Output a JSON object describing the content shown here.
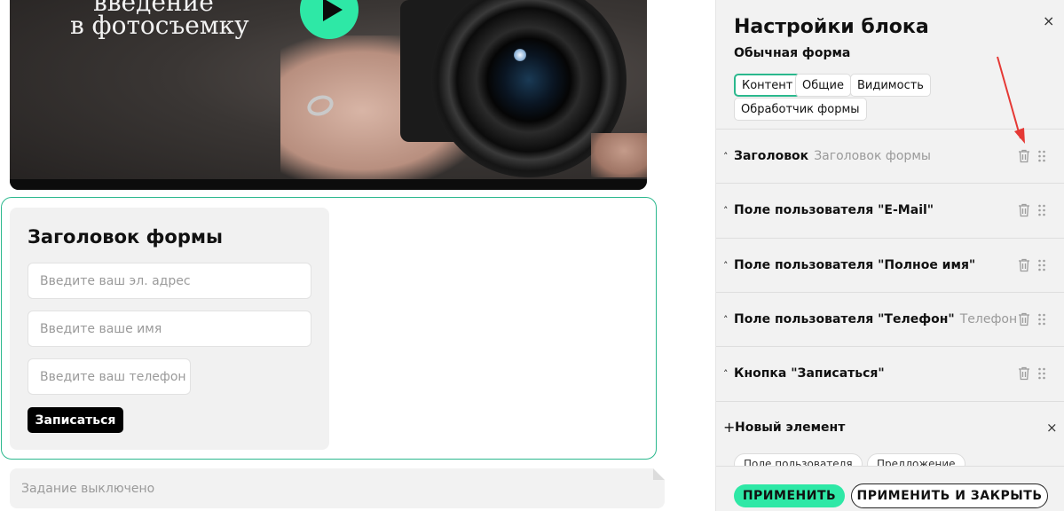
{
  "canvas": {
    "video": {
      "caption_line1": "введение",
      "caption_line2": "в фотосъемку"
    },
    "form": {
      "title": "Заголовок формы",
      "email_placeholder": "Введите ваш эл. адрес",
      "name_placeholder": "Введите ваше имя",
      "phone_placeholder": "Введите ваш телефон",
      "submit_label": "Записаться"
    },
    "task_status": "Задание выключено"
  },
  "panel": {
    "title": "Настройки блока",
    "subtitle": "Обычная форма",
    "close_icon": "×",
    "tabs": [
      {
        "label": "Контент",
        "active": true
      },
      {
        "label": "Общие",
        "active": false
      },
      {
        "label": "Видимость",
        "active": false
      },
      {
        "label": "Обработчик формы",
        "active": false
      }
    ],
    "items": [
      {
        "caret": "˄",
        "label": "Заголовок",
        "hint": "Заголовок формы"
      },
      {
        "caret": "˄",
        "label": "Поле пользователя \"E-Mail\"",
        "hint": ""
      },
      {
        "caret": "˄",
        "label": "Поле пользователя \"Полное имя\"",
        "hint": ""
      },
      {
        "caret": "˄",
        "label": "Поле пользователя \"Телефон\"",
        "hint": "Телефон"
      },
      {
        "caret": "˄",
        "label": "Кнопка \"Записаться\"",
        "hint": ""
      }
    ],
    "new_element": {
      "plus": "+",
      "label": "Новый элемент",
      "close": "×",
      "chips": [
        "Поле пользователя",
        "Предложение"
      ]
    },
    "footer": {
      "apply_label": "ПРИМЕНИТЬ",
      "apply_close_label": "ПРИМЕНИТЬ И ЗАКРЫТЬ"
    }
  },
  "colors": {
    "accent": "#2ee8a6",
    "block_outline": "#2bb88d",
    "annotation_arrow": "#e53935"
  }
}
